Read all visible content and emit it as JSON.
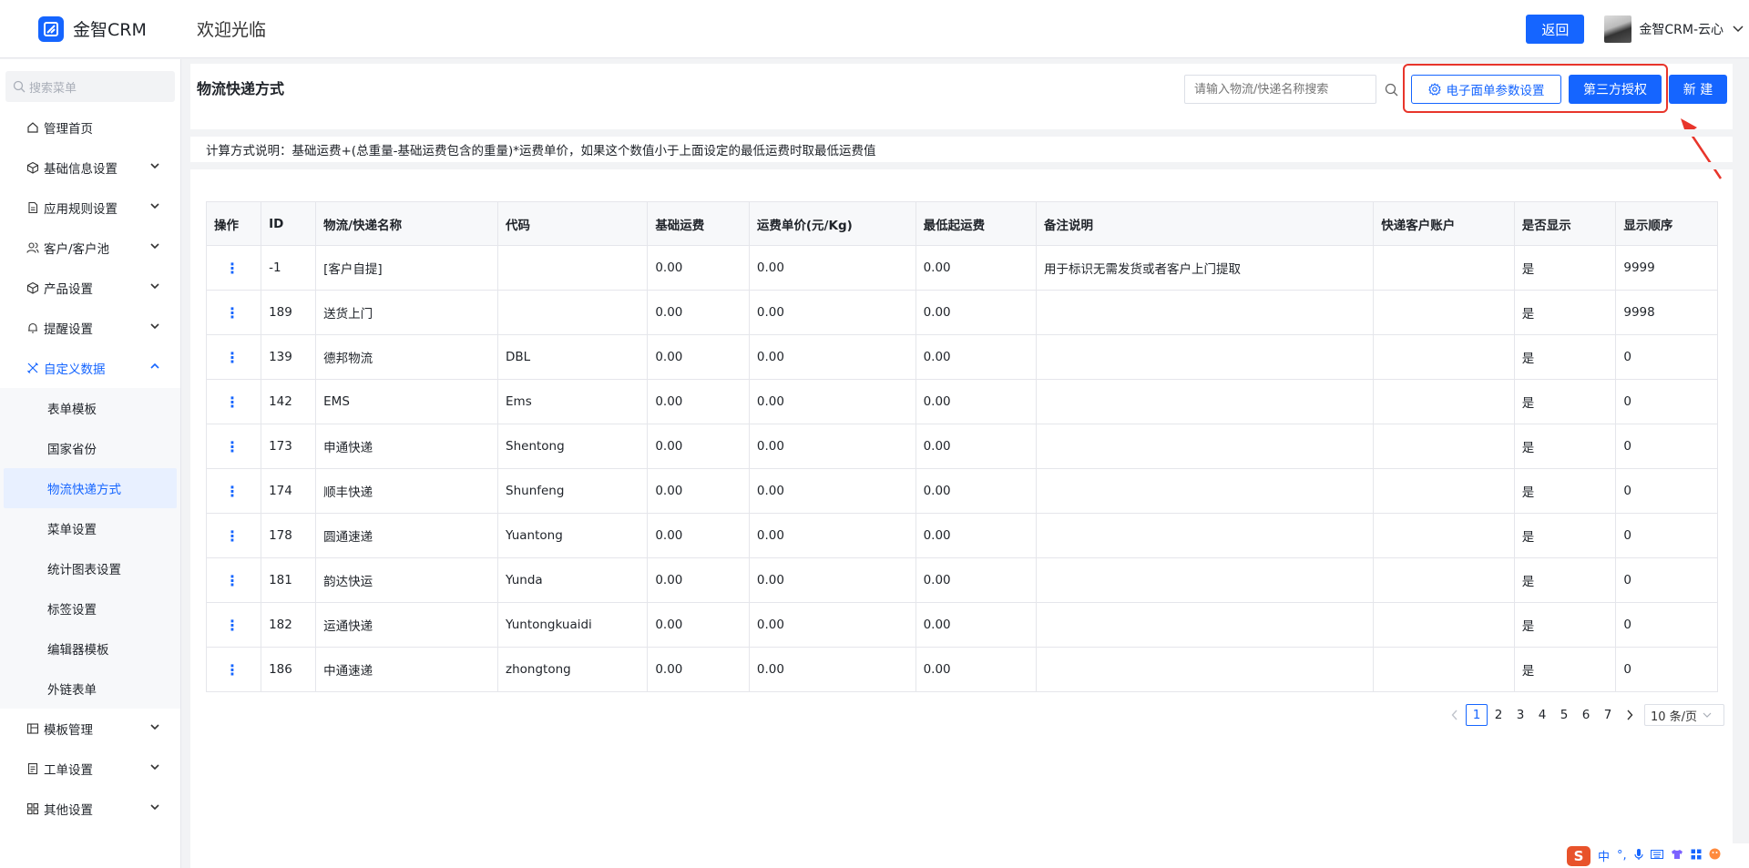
{
  "header": {
    "logo_text": "金智CRM",
    "welcome": "欢迎光临",
    "back_label": "返回",
    "user_name": "金智CRM-云心"
  },
  "sidebar": {
    "search_placeholder": "搜索菜单",
    "items": [
      {
        "label": "管理首页",
        "icon": "home-icon"
      },
      {
        "label": "基础信息设置",
        "icon": "cube-icon"
      },
      {
        "label": "应用规则设置",
        "icon": "document-icon"
      },
      {
        "label": "客户/客户池",
        "icon": "users-icon"
      },
      {
        "label": "产品设置",
        "icon": "cube-icon"
      },
      {
        "label": "提醒设置",
        "icon": "bell-icon"
      },
      {
        "label": "自定义数据",
        "icon": "tools-icon"
      }
    ],
    "sub_items": [
      "表单模板",
      "国家省份",
      "物流快递方式",
      "菜单设置",
      "统计图表设置",
      "标签设置",
      "编辑器模板",
      "外链表单"
    ],
    "bottom_items": [
      {
        "label": "模板管理",
        "icon": "template-icon"
      },
      {
        "label": "工单设置",
        "icon": "ticket-icon"
      },
      {
        "label": "其他设置",
        "icon": "grid-icon"
      }
    ]
  },
  "main": {
    "title": "物流快递方式",
    "search_placeholder": "请输入物流/快递名称搜索",
    "btn_eform": "电子面单参数设置",
    "btn_auth": "第三方授权",
    "btn_new": "新 建",
    "description": "计算方式说明：基础运费+(总重量-基础运费包含的重量)*运费单价，如果这个数值小于上面设定的最低运费时取最低运费值"
  },
  "table": {
    "columns": [
      "操作",
      "ID",
      "物流/快递名称",
      "代码",
      "基础运费",
      "运费单价(元/Kg)",
      "最低起运费",
      "备注说明",
      "快递客户账户",
      "是否显示",
      "显示顺序"
    ],
    "rows": [
      [
        "⋮",
        "-1",
        "[客户自提]",
        "",
        "0.00",
        "0.00",
        "0.00",
        "用于标识无需发货或者客户上门提取",
        "",
        "是",
        "9999"
      ],
      [
        "⋮",
        "189",
        "送货上门",
        "",
        "0.00",
        "0.00",
        "0.00",
        "",
        "",
        "是",
        "9998"
      ],
      [
        "⋮",
        "139",
        "德邦物流",
        "DBL",
        "0.00",
        "0.00",
        "0.00",
        "",
        "",
        "是",
        "0"
      ],
      [
        "⋮",
        "142",
        "EMS",
        "Ems",
        "0.00",
        "0.00",
        "0.00",
        "",
        "",
        "是",
        "0"
      ],
      [
        "⋮",
        "173",
        "申通快递",
        "Shentong",
        "0.00",
        "0.00",
        "0.00",
        "",
        "",
        "是",
        "0"
      ],
      [
        "⋮",
        "174",
        "顺丰快递",
        "Shunfeng",
        "0.00",
        "0.00",
        "0.00",
        "",
        "",
        "是",
        "0"
      ],
      [
        "⋮",
        "178",
        "圆通速递",
        "Yuantong",
        "0.00",
        "0.00",
        "0.00",
        "",
        "",
        "是",
        "0"
      ],
      [
        "⋮",
        "181",
        "韵达快运",
        "Yunda",
        "0.00",
        "0.00",
        "0.00",
        "",
        "",
        "是",
        "0"
      ],
      [
        "⋮",
        "182",
        "运通快递",
        "Yuntongkuaidi",
        "0.00",
        "0.00",
        "0.00",
        "",
        "",
        "是",
        "0"
      ],
      [
        "⋮",
        "186",
        "中通速递",
        "zhongtong",
        "0.00",
        "0.00",
        "0.00",
        "",
        "",
        "是",
        "0"
      ]
    ]
  },
  "pagination": {
    "pages": [
      "1",
      "2",
      "3",
      "4",
      "5",
      "6",
      "7"
    ],
    "current": "1",
    "page_size": "10 条/页"
  },
  "ime": {
    "logo": "S",
    "mode": "中"
  },
  "colors": {
    "primary": "#1565ff",
    "highlight": "#e8352b"
  }
}
